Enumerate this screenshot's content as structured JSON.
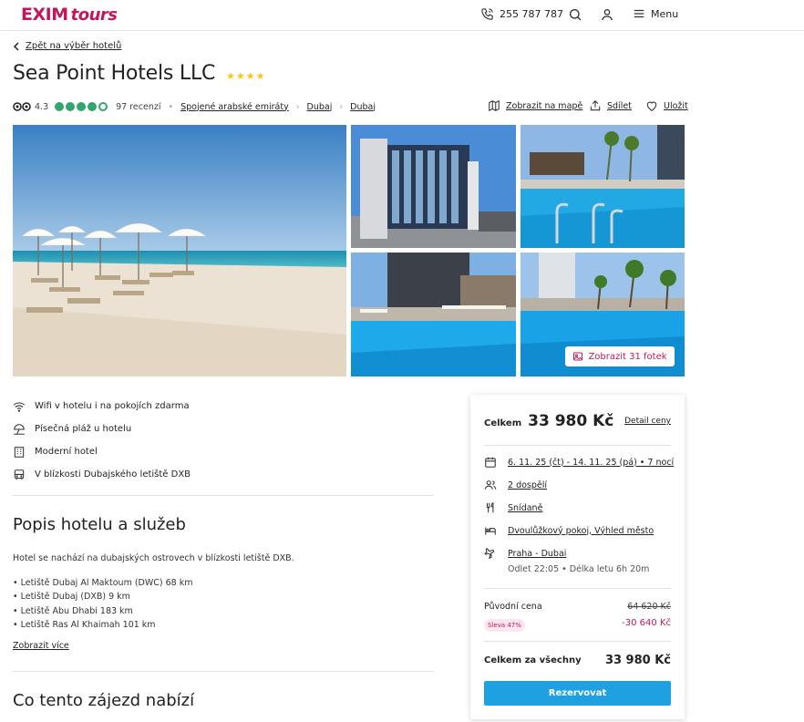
{
  "header": {
    "logo_main": "EXIM",
    "logo_sub": "tours",
    "phone": "255 787 787",
    "menu_label": "Menu"
  },
  "back_link": "Zpět na výběr hotelů",
  "hotel": {
    "name": "Sea Point Hotels LLC",
    "stars": "★★★★",
    "rating": "4.3",
    "reviews": "97 recenzí",
    "breadcrumb": [
      "Spojené arabské emiráty",
      "Dubaj",
      "Dubaj"
    ]
  },
  "actions": {
    "map": "Zobrazit na mapě",
    "share": "Sdílet",
    "save": "Uložit"
  },
  "gallery": {
    "show_photos": "Zobrazit 31 fotek"
  },
  "features": [
    {
      "icon": "wifi-icon",
      "text": "Wifi v hotelu i na pokojích zdarma"
    },
    {
      "icon": "beach-umbrella-icon",
      "text": "Písečná pláž u hotelu"
    },
    {
      "icon": "building-icon",
      "text": "Moderní hotel"
    },
    {
      "icon": "bus-icon",
      "text": "V blízkosti Dubajského letiště DXB"
    }
  ],
  "description": {
    "heading": "Popis hotelu a služeb",
    "text": "Hotel se nachází na dubajských ostrovech v blízkosti letiště DXB.",
    "bullets": [
      "Letiště Dubaj Al Maktoum (DWC) 68 km",
      "Letiště Dubaj (DXB) 9 km",
      "Letiště Abu Dhabi 183 km",
      "Letiště Ras Al Khaimah 101 km"
    ],
    "more": "Zobrazit více"
  },
  "offer_heading": "Co tento zájezd nabízí",
  "card": {
    "total_label": "Celkem",
    "total_value": "33 980 Kč",
    "detail": "Detail ceny",
    "dates": "6. 11. 25 (čt) - 14. 11. 25 (pá) • 7 nocí",
    "persons": "2 dospělí",
    "board": "Snídaně",
    "room": "Dvoulůžkový pokoj, Výhled město",
    "flight": "Praha - Dubai",
    "flight_info": "Odlet 22:05 • Délka letu 6h 20m",
    "original_label": "Původní cena",
    "original_value": "64 620 Kč",
    "discount_badge": "Sleva 47%",
    "discount_value": "-30 640 Kč",
    "all_label": "Celkem za všechny",
    "all_value": "33 980 Kč",
    "book": "Rezervovat"
  },
  "colors": {
    "brand": "#c2185b",
    "button": "#1ea0e1",
    "rating": "#34a56f",
    "stars": "#f5c518"
  }
}
